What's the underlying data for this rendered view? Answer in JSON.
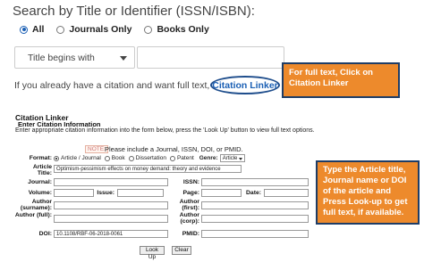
{
  "search": {
    "title": "Search by Title or Identifier (ISSN/ISBN):",
    "scope_options": [
      {
        "label": "All",
        "selected": true
      },
      {
        "label": "Journals Only",
        "selected": false
      },
      {
        "label": "Books Only",
        "selected": false
      }
    ],
    "match_select": "Title begins with",
    "query_value": ""
  },
  "citation_prompt": {
    "text": "If you already have a citation and want full text, try",
    "link_label": "Citation Linker"
  },
  "callout_top": "For full text, Click on Citation Linker",
  "callout_right": "Type the Article title, Journal name or DOI of the article and Press Look-up to get full text, if available.",
  "linker_form": {
    "title": "Citation Linker",
    "subtitle": "Enter Citation Information",
    "instructions": "Enter appropriate citation information into the form below, press the 'Look Up' button to view full text options.",
    "note_badge": "NOTE:",
    "note_text": "Please include a Journal, ISSN, DOI, or PMID.",
    "format_label": "Format:",
    "format_options": [
      {
        "label": "Article / Journal",
        "selected": true
      },
      {
        "label": "Book",
        "selected": false
      },
      {
        "label": "Dissertation",
        "selected": false
      },
      {
        "label": "Patent",
        "selected": false
      }
    ],
    "genre_label": "Genre:",
    "genre_value": "Article",
    "labels": {
      "article_title": "Article Title:",
      "journal": "Journal:",
      "issn": "ISSN:",
      "volume": "Volume:",
      "issue": "Issue:",
      "page": "Page:",
      "date": "Date:",
      "author_surname": "Author (surname):",
      "author_first": "Author (first):",
      "author_full": "Author (full):",
      "author_corp": "Author (corp):",
      "doi": "DOI:",
      "pmid": "PMID:"
    },
    "values": {
      "article_title": "Optimism-pessimism effects on money demand: theory and evidence",
      "journal": "",
      "issn": "",
      "volume": "",
      "issue": "",
      "page": "",
      "date": "",
      "author_surname": "",
      "author_first": "",
      "author_full": "",
      "author_corp": "",
      "doi": "10.1108/RBF-06-2018-0061",
      "pmid": ""
    },
    "lookup_button": "Look Up",
    "clear_button": "Clear"
  }
}
